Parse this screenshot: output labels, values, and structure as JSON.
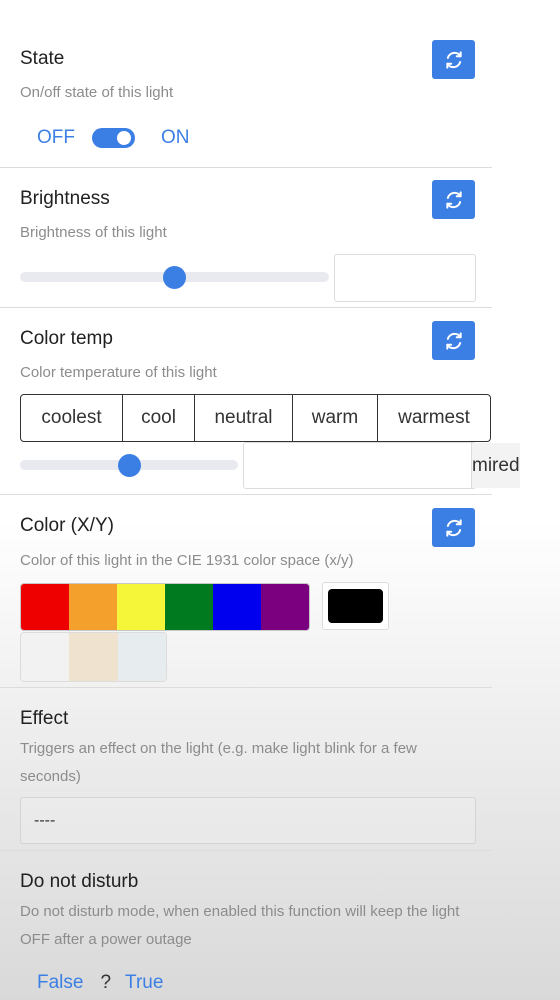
{
  "refresh_icon": "refresh-icon",
  "accent_color": "#3b7fe5",
  "state": {
    "title": "State",
    "description": "On/off state of this light",
    "off_label": "OFF",
    "on_label": "ON",
    "value": "ON"
  },
  "brightness": {
    "title": "Brightness",
    "description": "Brightness of this light",
    "slider_level": 0.5,
    "value": ""
  },
  "color_temp": {
    "title": "Color temp",
    "description": "Color temperature of this light",
    "presets": [
      "coolest",
      "cool",
      "neutral",
      "warm",
      "warmest"
    ],
    "slider_level": 0.5,
    "value": "",
    "unit": "mired"
  },
  "color_xy": {
    "title": "Color (X/Y)",
    "description": "Color of this light in the CIE 1931 color space (x/y)",
    "swatches": [
      "#ee0000",
      "#f4a02d",
      "#f5f53a",
      "#007a1f",
      "#0000ee",
      "#7b007f"
    ],
    "current_color": "#000000",
    "extra_swatches": [
      "#f2f2f2",
      "#efe3cf",
      "#e7ecee"
    ]
  },
  "effect": {
    "title": "Effect",
    "description": "Triggers an effect on the light (e.g. make light blink for a few seconds)",
    "selected": "----"
  },
  "do_not_disturb": {
    "title": "Do not disturb",
    "description": "Do not disturb mode, when enabled this function will keep the light OFF after a power outage",
    "false_label": "False",
    "unknown_label": "?",
    "true_label": "True"
  }
}
